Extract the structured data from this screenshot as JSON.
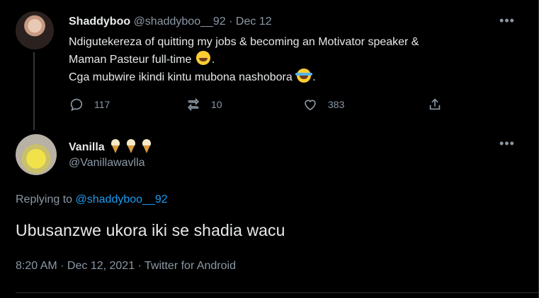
{
  "parent_tweet": {
    "name": "Shaddyboo",
    "handle": "@shaddyboo__92",
    "separator": "·",
    "date": "Dec 12",
    "line1": "Ndigutekereza of quitting my jobs & becoming an Motivator  speaker &",
    "line2": "Maman Pasteur  full-time",
    "line2_end": ".",
    "line3": "Cga mubwire ikindi kintu mubona nashobora",
    "line3_end": ".",
    "emoji1": "grinning-face-emoji",
    "emoji2": "tears-of-joy-emoji",
    "more_label": "•••",
    "replies": "117",
    "retweets": "10",
    "likes": "383",
    "icons": {
      "reply": "reply-icon",
      "retweet": "retweet-icon",
      "like": "heart-icon",
      "share": "share-icon",
      "more": "more-icon"
    }
  },
  "main_tweet": {
    "name": "Vanilla",
    "name_emoji": "ice-cream-emoji",
    "handle": "@Vanillawavlla",
    "more_label": "•••",
    "replying_prefix": "Replying to",
    "replying_to": "@shaddyboo__92",
    "text": "Ubusanzwe ukora iki se shadia wacu",
    "meta": "8:20 AM · Dec 12, 2021 · Twitter for Android"
  },
  "colors": {
    "background": "#000000",
    "text": "#e7e9ea",
    "muted": "#8b98a5",
    "link": "#1d9bf0"
  }
}
